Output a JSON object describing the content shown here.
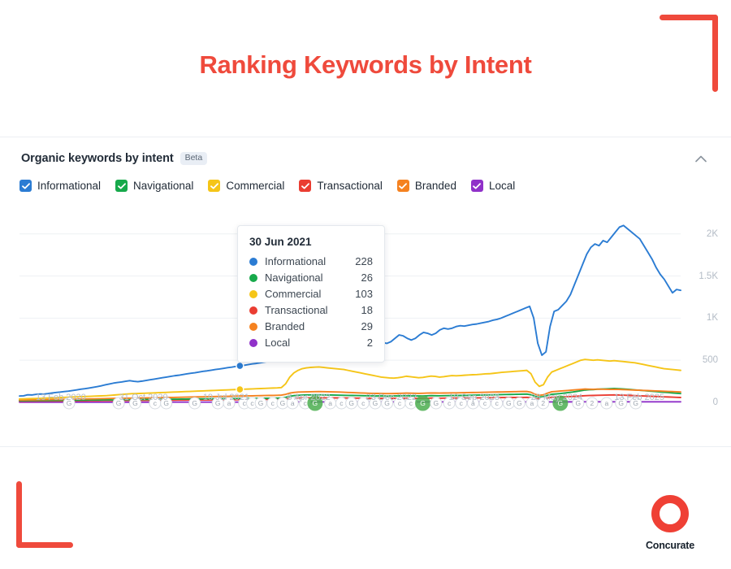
{
  "page_title": "Ranking Keywords by Intent",
  "accent_color": "#ef4a3c",
  "widget": {
    "title": "Organic keywords by intent",
    "badge": "Beta",
    "collapse_icon": "chevron-up-icon"
  },
  "legend": [
    {
      "label": "Informational",
      "color": "#2b7cd3",
      "checked": true
    },
    {
      "label": "Navigational",
      "color": "#17a94b",
      "checked": true
    },
    {
      "label": "Commercial",
      "color": "#f5c518",
      "checked": true
    },
    {
      "label": "Transactional",
      "color": "#ea3d32",
      "checked": true
    },
    {
      "label": "Branded",
      "color": "#f58220",
      "checked": true
    },
    {
      "label": "Local",
      "color": "#9031c9",
      "checked": true
    }
  ],
  "tooltip": {
    "date": "30 Jun 2021",
    "rows": [
      {
        "label": "Informational",
        "value": "228",
        "color": "#2b7cd3"
      },
      {
        "label": "Navigational",
        "value": "26",
        "color": "#17a94b"
      },
      {
        "label": "Commercial",
        "value": "103",
        "color": "#f5c518"
      },
      {
        "label": "Transactional",
        "value": "18",
        "color": "#ea3d32"
      },
      {
        "label": "Branded",
        "value": "29",
        "color": "#f58220"
      },
      {
        "label": "Local",
        "value": "2",
        "color": "#9031c9"
      }
    ]
  },
  "brand": {
    "name": "Concurate",
    "mark": "ring-logo-icon",
    "color": "#ef4035"
  },
  "chart_data": {
    "type": "line",
    "title": "Organic keywords by intent",
    "xlabel": "",
    "ylabel": "",
    "grid": true,
    "legend_position": "top",
    "ylim": [
      0,
      2200
    ],
    "y_ticks": [
      "0",
      "500",
      "1K",
      "1.5K",
      "2K"
    ],
    "y_tick_values": [
      0,
      500,
      1000,
      1500,
      2000
    ],
    "x_ticks": [
      "13 Feb 2020",
      "31 Oct 2020",
      "19 Jul 2021",
      "6 Apr 2022",
      "23 Dec 2022",
      "10 Sep 2023",
      "28 May 2024",
      "13 Feb 2025"
    ],
    "hover_point": {
      "date": "30 Jun 2021",
      "x_fraction": 0.335
    },
    "annotations": {
      "type": "google-algorithm-update-markers",
      "labels": [
        "G",
        "a",
        "2"
      ],
      "description": "circular algorithm-update markers along the x axis; several highlighted in green"
    },
    "series": [
      {
        "name": "Informational",
        "color": "#2b7cd3",
        "values": [
          75,
          78,
          90,
          88,
          95,
          100,
          98,
          104,
          112,
          118,
          122,
          128,
          133,
          140,
          148,
          156,
          162,
          170,
          178,
          186,
          196,
          208,
          218,
          228,
          236,
          242,
          250,
          258,
          250,
          246,
          252,
          260,
          268,
          276,
          284,
          292,
          300,
          308,
          316,
          322,
          330,
          338,
          346,
          352,
          360,
          368,
          374,
          382,
          390,
          396,
          404,
          412,
          418,
          426,
          434,
          440,
          448,
          456,
          462,
          470,
          478,
          486,
          494,
          500,
          560,
          700,
          800,
          860,
          900,
          920,
          940,
          960,
          975,
          985,
          1000,
          990,
          1010,
          1030,
          1050,
          1040,
          1020,
          1000,
          960,
          920,
          880,
          840,
          800,
          760,
          730,
          710,
          700,
          720,
          760,
          800,
          790,
          760,
          740,
          760,
          800,
          830,
          820,
          800,
          820,
          860,
          880,
          870,
          880,
          900,
          910,
          905,
          915,
          925,
          930,
          940,
          950,
          960,
          975,
          985,
          1000,
          1020,
          1040,
          1060,
          1080,
          1100,
          1120,
          1140,
          1000,
          700,
          560,
          600,
          900,
          1080,
          1100,
          1150,
          1200,
          1280,
          1400,
          1520,
          1640,
          1760,
          1840,
          1880,
          1860,
          1920,
          1900,
          1960,
          2020,
          2080,
          2100,
          2060,
          2020,
          1980,
          1940,
          1860,
          1780,
          1700,
          1600,
          1520,
          1460,
          1380,
          1300,
          1340,
          1330
        ]
      },
      {
        "name": "Commercial",
        "color": "#f5c518",
        "values": [
          40,
          42,
          44,
          45,
          46,
          48,
          50,
          52,
          54,
          56,
          58,
          60,
          62,
          64,
          66,
          68,
          70,
          72,
          74,
          76,
          78,
          80,
          84,
          88,
          92,
          96,
          100,
          103,
          104,
          106,
          108,
          110,
          112,
          114,
          116,
          118,
          120,
          122,
          124,
          126,
          128,
          130,
          132,
          134,
          136,
          138,
          140,
          142,
          144,
          146,
          148,
          150,
          152,
          154,
          156,
          158,
          160,
          162,
          164,
          166,
          168,
          170,
          172,
          176,
          220,
          300,
          350,
          380,
          400,
          410,
          415,
          418,
          420,
          415,
          410,
          405,
          400,
          395,
          390,
          380,
          370,
          360,
          350,
          340,
          330,
          320,
          310,
          300,
          295,
          290,
          288,
          292,
          300,
          310,
          305,
          298,
          292,
          296,
          304,
          312,
          308,
          300,
          305,
          312,
          318,
          315,
          318,
          322,
          325,
          328,
          330,
          334,
          338,
          340,
          345,
          350,
          356,
          360,
          364,
          368,
          372,
          376,
          380,
          340,
          240,
          190,
          210,
          300,
          360,
          380,
          400,
          420,
          440,
          460,
          480,
          500,
          510,
          505,
          500,
          505,
          500,
          495,
          490,
          495,
          490,
          485,
          480,
          475,
          470,
          460,
          450,
          440,
          430,
          420,
          410,
          400,
          395,
          390,
          385,
          380
        ]
      },
      {
        "name": "Branded",
        "color": "#f58220",
        "values": [
          28,
          29,
          30,
          30,
          31,
          32,
          32,
          33,
          34,
          35,
          35,
          36,
          37,
          38,
          39,
          40,
          40,
          41,
          42,
          43,
          44,
          45,
          46,
          47,
          48,
          49,
          50,
          50,
          51,
          52,
          52,
          53,
          54,
          55,
          56,
          57,
          58,
          59,
          60,
          61,
          62,
          63,
          64,
          65,
          66,
          67,
          68,
          69,
          70,
          71,
          72,
          73,
          74,
          75,
          76,
          77,
          78,
          79,
          80,
          81,
          82,
          83,
          84,
          86,
          95,
          110,
          118,
          122,
          124,
          125,
          126,
          127,
          128,
          127,
          126,
          125,
          124,
          122,
          120,
          118,
          116,
          114,
          112,
          110,
          108,
          107,
          106,
          105,
          104,
          104,
          105,
          106,
          108,
          110,
          109,
          108,
          107,
          108,
          110,
          112,
          111,
          110,
          111,
          112,
          113,
          113,
          114,
          115,
          116,
          117,
          118,
          119,
          120,
          121,
          122,
          123,
          124,
          125,
          126,
          127,
          128,
          129,
          130,
          120,
          96,
          84,
          90,
          110,
          126,
          130,
          134,
          138,
          142,
          146,
          150,
          154,
          158,
          156,
          155,
          157,
          156,
          155,
          154,
          155,
          154,
          152,
          150,
          148,
          146,
          144,
          142,
          140,
          138,
          136,
          134,
          132,
          130,
          128,
          126,
          124
        ]
      },
      {
        "name": "Navigational",
        "color": "#17a94b",
        "values": [
          20,
          20,
          21,
          21,
          22,
          22,
          23,
          23,
          24,
          24,
          25,
          25,
          26,
          26,
          26,
          27,
          27,
          28,
          28,
          29,
          29,
          30,
          30,
          26,
          31,
          32,
          32,
          33,
          33,
          34,
          34,
          35,
          35,
          36,
          36,
          37,
          37,
          38,
          38,
          39,
          39,
          40,
          40,
          41,
          41,
          42,
          42,
          43,
          43,
          44,
          44,
          45,
          45,
          46,
          46,
          47,
          47,
          48,
          48,
          49,
          49,
          50,
          50,
          52,
          60,
          72,
          80,
          84,
          86,
          88,
          89,
          90,
          90,
          89,
          88,
          87,
          86,
          85,
          84,
          83,
          82,
          81,
          80,
          79,
          78,
          77,
          76,
          76,
          75,
          75,
          76,
          77,
          78,
          79,
          78,
          77,
          76,
          77,
          78,
          80,
          79,
          78,
          79,
          80,
          81,
          81,
          82,
          83,
          84,
          85,
          86,
          87,
          88,
          89,
          90,
          91,
          92,
          93,
          94,
          95,
          96,
          97,
          98,
          90,
          72,
          62,
          68,
          84,
          96,
          100,
          104,
          110,
          116,
          122,
          130,
          138,
          146,
          150,
          152,
          156,
          158,
          160,
          162,
          164,
          162,
          160,
          156,
          152,
          148,
          144,
          140,
          136,
          132,
          128,
          124,
          120,
          116,
          112,
          108,
          104
        ]
      },
      {
        "name": "Transactional",
        "color": "#ea3d32",
        "values": [
          14,
          14,
          15,
          15,
          15,
          16,
          16,
          16,
          17,
          17,
          17,
          18,
          18,
          18,
          19,
          19,
          19,
          20,
          20,
          20,
          21,
          21,
          21,
          18,
          22,
          22,
          23,
          23,
          23,
          24,
          24,
          24,
          25,
          25,
          25,
          26,
          26,
          26,
          27,
          27,
          27,
          28,
          28,
          28,
          29,
          29,
          29,
          30,
          30,
          30,
          31,
          31,
          31,
          32,
          32,
          32,
          33,
          33,
          33,
          34,
          34,
          34,
          35,
          36,
          40,
          46,
          50,
          52,
          53,
          54,
          54,
          55,
          55,
          54,
          54,
          53,
          53,
          52,
          52,
          51,
          51,
          50,
          50,
          49,
          49,
          48,
          48,
          48,
          47,
          47,
          48,
          48,
          49,
          50,
          49,
          48,
          48,
          49,
          50,
          51,
          50,
          49,
          50,
          50,
          51,
          51,
          52,
          52,
          53,
          53,
          54,
          54,
          55,
          55,
          56,
          56,
          57,
          57,
          58,
          58,
          59,
          59,
          60,
          56,
          46,
          40,
          43,
          52,
          60,
          62,
          64,
          66,
          68,
          70,
          73,
          76,
          79,
          81,
          82,
          84,
          85,
          86,
          87,
          88,
          87,
          86,
          84,
          82,
          80,
          78,
          76,
          74,
          72,
          70,
          68,
          66,
          64,
          62,
          60,
          58
        ]
      },
      {
        "name": "Local",
        "color": "#9031c9",
        "values": [
          2,
          2,
          2,
          2,
          2,
          2,
          2,
          2,
          2,
          2,
          2,
          2,
          2,
          2,
          2,
          2,
          2,
          2,
          2,
          2,
          2,
          2,
          2,
          2,
          2,
          2,
          2,
          2,
          2,
          2,
          2,
          2,
          2,
          2,
          3,
          3,
          3,
          3,
          3,
          3,
          3,
          3,
          3,
          3,
          3,
          3,
          3,
          3,
          3,
          3,
          3,
          3,
          3,
          3,
          3,
          3,
          3,
          3,
          3,
          3,
          3,
          3,
          3,
          3,
          4,
          5,
          5,
          5,
          5,
          5,
          5,
          5,
          5,
          5,
          5,
          5,
          5,
          5,
          5,
          5,
          5,
          5,
          5,
          5,
          5,
          5,
          5,
          5,
          5,
          5,
          5,
          5,
          5,
          5,
          5,
          5,
          5,
          5,
          5,
          5,
          5,
          5,
          5,
          5,
          5,
          5,
          5,
          5,
          5,
          5,
          5,
          5,
          5,
          5,
          5,
          5,
          5,
          5,
          5,
          5,
          5,
          5,
          5,
          5,
          4,
          4,
          4,
          5,
          5,
          5,
          5,
          6,
          6,
          6,
          6,
          7,
          7,
          7,
          7,
          7,
          7,
          7,
          7,
          7,
          7,
          7,
          7,
          7,
          7,
          7,
          7,
          7,
          7,
          7,
          7,
          7,
          7,
          7,
          7,
          7
        ]
      }
    ]
  }
}
